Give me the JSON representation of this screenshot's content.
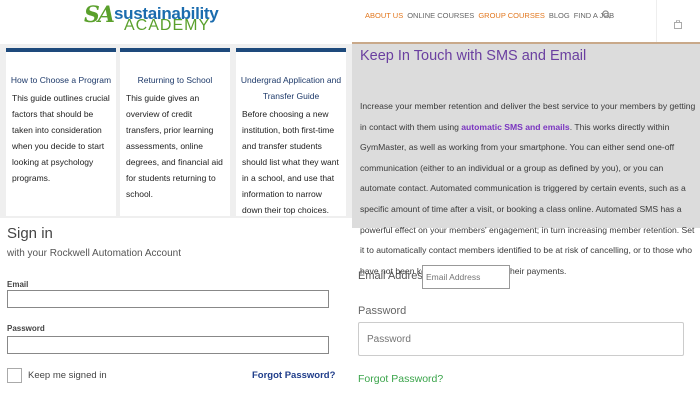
{
  "header": {
    "logo_mark": "SA",
    "logo_line1": "sustainability",
    "logo_line2": "ACADEMY",
    "nav": [
      {
        "label": "ABOUT US",
        "active": true
      },
      {
        "label": "ONLINE COURSES",
        "active": false
      },
      {
        "label": "GROUP COURSES",
        "active": true
      },
      {
        "label": "BLOG",
        "active": false
      },
      {
        "label": "FIND A JOB",
        "active": false
      }
    ],
    "search_icon": "search-icon",
    "cart_icon": "cart-icon"
  },
  "cards": [
    {
      "title": "How to Choose a Program",
      "body": "This guide outlines crucial factors that should be taken into consideration when you decide to start looking at psychology programs."
    },
    {
      "title": "Returning to School",
      "body": "This guide gives an overview of credit transfers, prior learning assessments, online degrees, and financial aid for students returning to school."
    },
    {
      "title": "Undergrad Application and Transfer Guide",
      "body": "Before choosing a new institution, both first-time and transfer students should list what they want in a school, and use that information to narrow down their top choices."
    }
  ],
  "sms": {
    "heading": "Keep In Touch with SMS and Email",
    "body_before": "Increase your member retention and deliver the best service to your members by getting in contact with them using ",
    "body_highlight": "automatic SMS and emails",
    "body_after": ". This works directly within GymMaster, as well as working from your smartphone. You can either send one-off communication (either to an individual or a group as defined by you), or you can automate contact. Automated communication is triggered by certain events, such as a specific amount of time after a visit, or booking a class online. Automated SMS has a powerful effect on your members' engagement; in turn increasing member retention. Set it to automatically contact members identified to be at risk of cancelling, or to those who have not been keeping up to date with their payments."
  },
  "signin": {
    "title": "Sign in",
    "subtitle": "with your Rockwell Automation Account",
    "email_label": "Email",
    "email_value": "",
    "password_label": "Password",
    "password_value": "",
    "keep_signed_in": "Keep me signed in",
    "forgot": "Forgot Password?"
  },
  "login_right": {
    "email_label": "Email Address",
    "email_placeholder": "Email Address",
    "password_label": "Password",
    "password_placeholder": "Password",
    "forgot": "Forgot Password?"
  },
  "colors": {
    "accent_orange": "#e2771e",
    "card_bar": "#1e4a7c",
    "sms_heading": "#6a3fa0",
    "forgot_green": "#3aa44a",
    "forgot_blue": "#1f3d8a"
  }
}
